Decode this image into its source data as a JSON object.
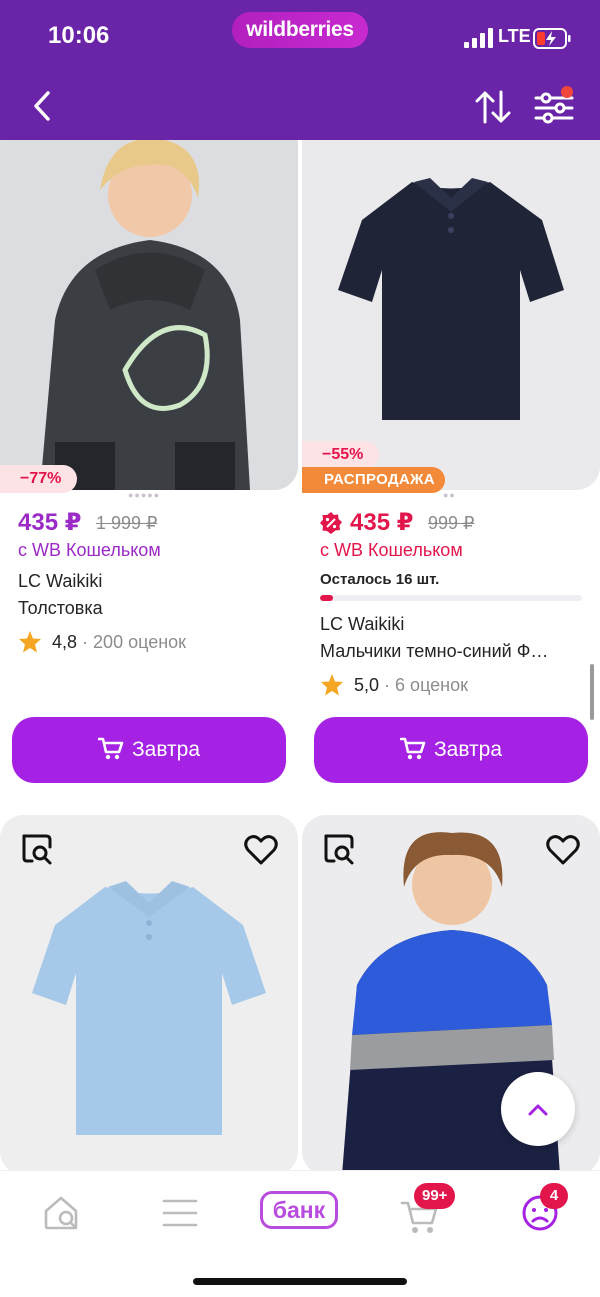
{
  "status": {
    "time": "10:06",
    "network": "LTE"
  },
  "header": {
    "logo": "wildberries"
  },
  "products": [
    {
      "discount": "−77%",
      "price": "435 ₽",
      "old_price": "1 999 ₽",
      "wallet": "с WB Кошельком",
      "brand": "LC Waikiki",
      "name": "Толстовка",
      "rating": "4,8",
      "reviews": "· 200 оценок",
      "button": "Завтра"
    },
    {
      "discount": "−55%",
      "sale_label": "РАСПРОДАЖА",
      "price": "435 ₽",
      "old_price": "999 ₽",
      "wallet": "с WB Кошельком",
      "stock": "Осталось 16 шт.",
      "stock_fraction": 0.05,
      "brand": "LC Waikiki",
      "name": "Мальчики темно-синий Ф…",
      "rating": "5,0",
      "reviews": "· 6 оценок",
      "button": "Завтра"
    }
  ],
  "tabbar": {
    "bank": "банк",
    "cart_badge": "99+",
    "profile_badge": "4"
  },
  "colors": {
    "brand": "#6a24a8",
    "accent": "#a521e3",
    "discount": "#e3164b",
    "sale": "#f38a3a"
  },
  "icons": [
    "back-icon",
    "sort-icon",
    "filter-icon",
    "search-photo-icon",
    "heart-icon",
    "cart-icon",
    "star-icon",
    "home-icon",
    "catalog-icon",
    "profile-icon",
    "arrow-up-icon"
  ]
}
